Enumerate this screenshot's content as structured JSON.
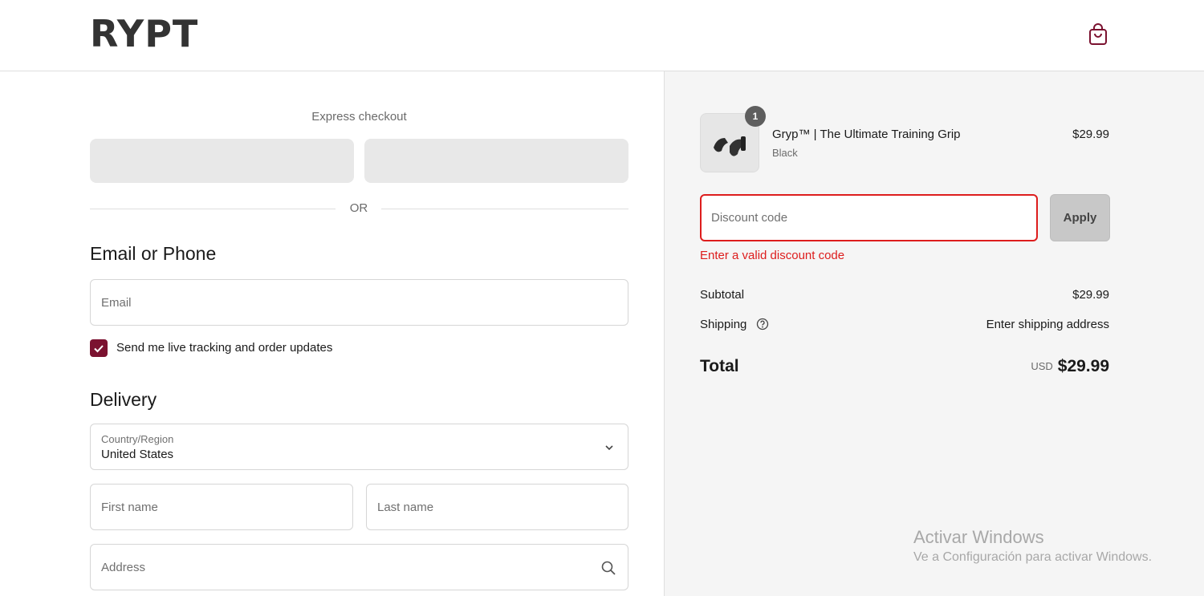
{
  "header": {
    "logo": "RYPT",
    "cart_icon": "shopping-bag-icon"
  },
  "express": {
    "label": "Express checkout",
    "or_text": "OR"
  },
  "contact": {
    "title": "Email or Phone",
    "email_placeholder": "Email",
    "updates_label": "Send me live tracking and order updates",
    "updates_checked": true
  },
  "delivery": {
    "title": "Delivery",
    "country_label": "Country/Region",
    "country_value": "United States",
    "first_name_placeholder": "First name",
    "last_name_placeholder": "Last name",
    "address_placeholder": "Address"
  },
  "order": {
    "item": {
      "quantity": "1",
      "name": "Gryp™ | The Ultimate Training Grip",
      "variant": "Black",
      "price": "$29.99"
    },
    "discount": {
      "placeholder": "Discount code",
      "apply_label": "Apply",
      "error": "Enter a valid discount code"
    },
    "subtotal_label": "Subtotal",
    "subtotal_value": "$29.99",
    "shipping_label": "Shipping",
    "shipping_value": "Enter shipping address",
    "total_label": "Total",
    "total_currency": "USD",
    "total_value": "$29.99"
  },
  "watermark": {
    "title": "Activar Windows",
    "subtitle": "Ve a Configuración para activar Windows."
  },
  "colors": {
    "accent": "#7b1230",
    "error": "#dd1d1d",
    "summary_bg": "#f5f5f5"
  }
}
